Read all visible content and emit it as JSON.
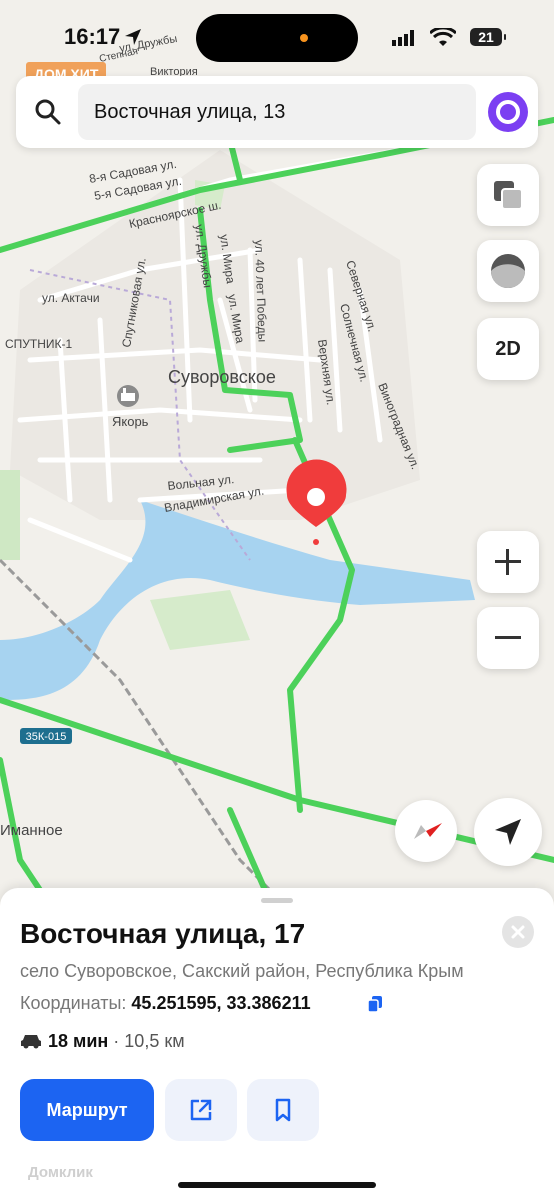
{
  "status": {
    "time": "16:17",
    "battery": "21"
  },
  "ad_badge": "ДОМ ХИТ",
  "search": {
    "value": "Восточная улица, 13"
  },
  "controls": {
    "mode_label": "2D"
  },
  "map_labels": {
    "village": "Суворовское",
    "anchor": "Якорь",
    "sputnik": "СПУТНИК-1",
    "limannoe": "Иманное",
    "road_code": "35К-015",
    "streets": {
      "mira": "ул. Мира",
      "mira2": "ул. Мира",
      "druzhby": "ул. Дружбы",
      "druzhby_top": "ул. Дружбы",
      "pobedy": "ул. 40 лет Победы",
      "severnaya": "Северная ул.",
      "solnechnaya": "Солнечная ул.",
      "verhnyaya": "Верхняя ул.",
      "vinogradnaya": "Виноградная ул.",
      "aktachi": "ул. Актачи",
      "sputnikovaya": "Спутниковая ул.",
      "sadovaya8": "8-я Садовая ул.",
      "sadovaya5": "5-я Садовая ул.",
      "krasnoyarskoe": "Красноярское ш.",
      "volnaya": "Вольная ул.",
      "vladimirskaya": "Владимирская ул.",
      "stepnaya": "Степная",
      "viktoriya": "Виктория"
    }
  },
  "place": {
    "title": "Восточная улица, 17",
    "address": "село Суворовское, Сакский район, Республика Крым",
    "coords_label": "Координаты:",
    "coords_value": "45.251595, 33.386211",
    "travel_time": "18 мин",
    "travel_distance": "· 10,5 км",
    "route_label": "Маршрут",
    "footer": "Домклик"
  },
  "colors": {
    "accent": "#1c64f2",
    "pin": "#f03c3c",
    "route": "#4cd15a",
    "water": "#a7d3f0"
  }
}
